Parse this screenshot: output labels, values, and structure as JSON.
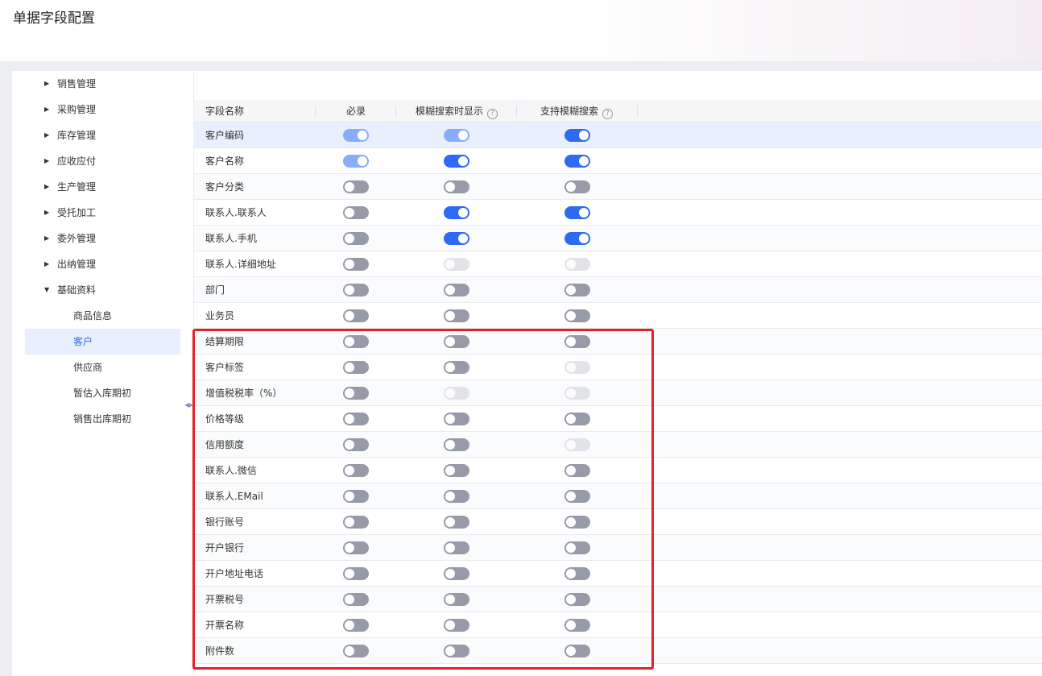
{
  "page_title": "单据字段配置",
  "sidebar": {
    "items": [
      {
        "label": "销售管理",
        "level": 1,
        "arrow": "▶"
      },
      {
        "label": "采购管理",
        "level": 1,
        "arrow": "▶"
      },
      {
        "label": "库存管理",
        "level": 1,
        "arrow": "▶"
      },
      {
        "label": "应收应付",
        "level": 1,
        "arrow": "▶"
      },
      {
        "label": "生产管理",
        "level": 1,
        "arrow": "▶"
      },
      {
        "label": "受托加工",
        "level": 1,
        "arrow": "▶"
      },
      {
        "label": "委外管理",
        "level": 1,
        "arrow": "▶"
      },
      {
        "label": "出纳管理",
        "level": 1,
        "arrow": "▶"
      },
      {
        "label": "基础资料",
        "level": 1,
        "arrow": "▼"
      },
      {
        "label": "商品信息",
        "level": 2
      },
      {
        "label": "客户",
        "level": 2,
        "active": true
      },
      {
        "label": "供应商",
        "level": 2
      },
      {
        "label": "暂估入库期初",
        "level": 2
      },
      {
        "label": "销售出库期初",
        "level": 2
      }
    ]
  },
  "collapse_arrows": "◀▶",
  "table": {
    "headers": {
      "name": "字段名称",
      "required": "必录",
      "fuzzy_display": "模糊搜索时显示",
      "fuzzy_support": "支持模糊搜索",
      "help_glyph": "?"
    },
    "rows": [
      {
        "name": "客户编码",
        "required": "on-dim",
        "fuzzy_display": "on-dim",
        "fuzzy_support": "on"
      },
      {
        "name": "客户名称",
        "required": "on-dim",
        "fuzzy_display": "on",
        "fuzzy_support": "on"
      },
      {
        "name": "客户分类",
        "required": "off",
        "fuzzy_display": "off",
        "fuzzy_support": "off"
      },
      {
        "name": "联系人.联系人",
        "required": "off",
        "fuzzy_display": "on",
        "fuzzy_support": "on"
      },
      {
        "name": "联系人.手机",
        "required": "off",
        "fuzzy_display": "on",
        "fuzzy_support": "on"
      },
      {
        "name": "联系人.详细地址",
        "required": "off",
        "fuzzy_display": "disabled",
        "fuzzy_support": "disabled"
      },
      {
        "name": "部门",
        "required": "off",
        "fuzzy_display": "off",
        "fuzzy_support": "off"
      },
      {
        "name": "业务员",
        "required": "off",
        "fuzzy_display": "off",
        "fuzzy_support": "off"
      },
      {
        "name": "结算期限",
        "required": "off",
        "fuzzy_display": "off",
        "fuzzy_support": "off"
      },
      {
        "name": "客户标签",
        "required": "off",
        "fuzzy_display": "off",
        "fuzzy_support": "disabled"
      },
      {
        "name": "增值税税率（%）",
        "required": "off",
        "fuzzy_display": "disabled",
        "fuzzy_support": "disabled"
      },
      {
        "name": "价格等级",
        "required": "off",
        "fuzzy_display": "off",
        "fuzzy_support": "off"
      },
      {
        "name": "信用额度",
        "required": "off",
        "fuzzy_display": "off",
        "fuzzy_support": "disabled"
      },
      {
        "name": "联系人.微信",
        "required": "off",
        "fuzzy_display": "off",
        "fuzzy_support": "off"
      },
      {
        "name": "联系人.EMail",
        "required": "off",
        "fuzzy_display": "off",
        "fuzzy_support": "off"
      },
      {
        "name": "银行账号",
        "required": "off",
        "fuzzy_display": "off",
        "fuzzy_support": "off"
      },
      {
        "name": "开户银行",
        "required": "off",
        "fuzzy_display": "off",
        "fuzzy_support": "off"
      },
      {
        "name": "开户地址电话",
        "required": "off",
        "fuzzy_display": "off",
        "fuzzy_support": "off"
      },
      {
        "name": "开票税号",
        "required": "off",
        "fuzzy_display": "off",
        "fuzzy_support": "off"
      },
      {
        "name": "开票名称",
        "required": "off",
        "fuzzy_display": "off",
        "fuzzy_support": "off"
      },
      {
        "name": "附件数",
        "required": "off",
        "fuzzy_display": "off",
        "fuzzy_support": "off"
      }
    ]
  },
  "colors": {
    "accent": "#2e6bf0",
    "accent_dim": "#86adf5",
    "toggle_off": "#979aa8",
    "toggle_disabled": "#e2e3e8",
    "highlight_border": "#e8202a",
    "active_nav_bg": "#e8effd"
  }
}
